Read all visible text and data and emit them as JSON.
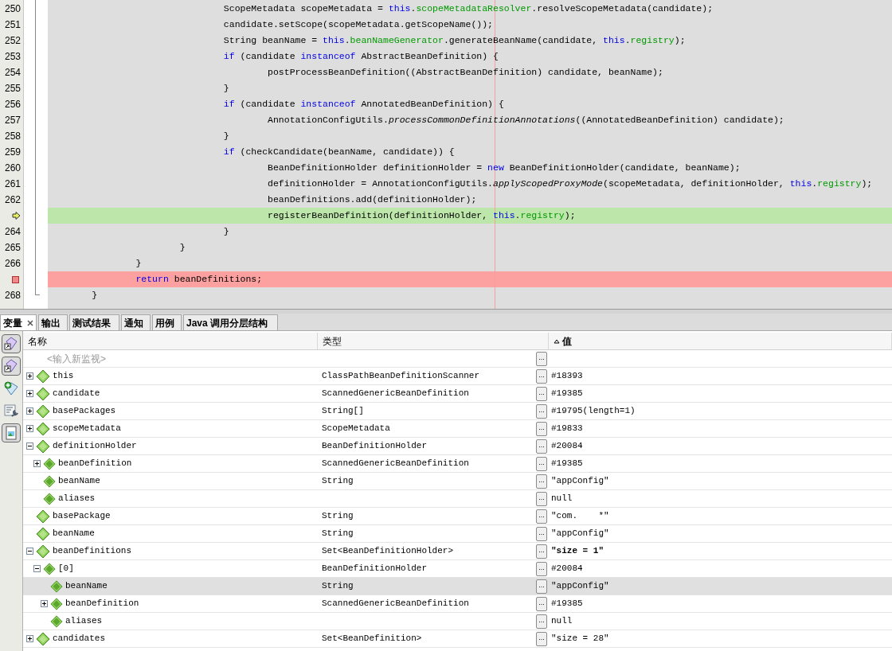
{
  "editor": {
    "lines": [
      {
        "number": "250",
        "kind": "normal",
        "segments": [
          {
            "kind": "plain",
            "text": "                                ScopeMetadata scopeMetadata = "
          },
          {
            "kind": "keyword",
            "text": "this"
          },
          {
            "kind": "plain",
            "text": "."
          },
          {
            "kind": "field",
            "text": "scopeMetadataResolver"
          },
          {
            "kind": "plain",
            "text": ".resolveScopeMetadata(candidate);"
          }
        ]
      },
      {
        "number": "251",
        "kind": "normal",
        "segments": [
          {
            "kind": "plain",
            "text": "                                candidate.setScope(scopeMetadata.getScopeName());"
          }
        ]
      },
      {
        "number": "252",
        "kind": "normal",
        "segments": [
          {
            "kind": "plain",
            "text": "                                String beanName = "
          },
          {
            "kind": "keyword",
            "text": "this"
          },
          {
            "kind": "plain",
            "text": "."
          },
          {
            "kind": "field",
            "text": "beanNameGenerator"
          },
          {
            "kind": "plain",
            "text": ".generateBeanName(candidate, "
          },
          {
            "kind": "keyword",
            "text": "this"
          },
          {
            "kind": "plain",
            "text": "."
          },
          {
            "kind": "field",
            "text": "registry"
          },
          {
            "kind": "plain",
            "text": ");"
          }
        ]
      },
      {
        "number": "253",
        "kind": "normal",
        "segments": [
          {
            "kind": "keyword",
            "text": "                                if"
          },
          {
            "kind": "plain",
            "text": " (candidate "
          },
          {
            "kind": "keyword",
            "text": "instanceof"
          },
          {
            "kind": "plain",
            "text": " AbstractBeanDefinition) {"
          }
        ]
      },
      {
        "number": "254",
        "kind": "normal",
        "segments": [
          {
            "kind": "plain",
            "text": "                                        postProcessBeanDefinition((AbstractBeanDefinition) candidate, beanName);"
          }
        ]
      },
      {
        "number": "255",
        "kind": "normal",
        "segments": [
          {
            "kind": "plain",
            "text": "                                }"
          }
        ]
      },
      {
        "number": "256",
        "kind": "normal",
        "segments": [
          {
            "kind": "keyword",
            "text": "                                if"
          },
          {
            "kind": "plain",
            "text": " (candidate "
          },
          {
            "kind": "keyword",
            "text": "instanceof"
          },
          {
            "kind": "plain",
            "text": " AnnotatedBeanDefinition) {"
          }
        ]
      },
      {
        "number": "257",
        "kind": "normal",
        "segments": [
          {
            "kind": "plain",
            "text": "                                        AnnotationConfigUtils."
          },
          {
            "kind": "static",
            "text": "processCommonDefinitionAnnotations"
          },
          {
            "kind": "plain",
            "text": "((AnnotatedBeanDefinition) candidate);"
          }
        ]
      },
      {
        "number": "258",
        "kind": "normal",
        "segments": [
          {
            "kind": "plain",
            "text": "                                }"
          }
        ]
      },
      {
        "number": "259",
        "kind": "normal",
        "segments": [
          {
            "kind": "keyword",
            "text": "                                if"
          },
          {
            "kind": "plain",
            "text": " (checkCandidate(beanName, candidate)) {"
          }
        ]
      },
      {
        "number": "260",
        "kind": "normal",
        "segments": [
          {
            "kind": "plain",
            "text": "                                        BeanDefinitionHolder definitionHolder = "
          },
          {
            "kind": "keyword",
            "text": "new"
          },
          {
            "kind": "plain",
            "text": " BeanDefinitionHolder(candidate, beanName);"
          }
        ]
      },
      {
        "number": "261",
        "kind": "normal",
        "segments": [
          {
            "kind": "plain",
            "text": "                                        definitionHolder = AnnotationConfigUtils."
          },
          {
            "kind": "static",
            "text": "applyScopedProxyMode"
          },
          {
            "kind": "plain",
            "text": "(scopeMetadata, definitionHolder, "
          },
          {
            "kind": "keyword",
            "text": "this"
          },
          {
            "kind": "plain",
            "text": "."
          },
          {
            "kind": "field",
            "text": "registry"
          },
          {
            "kind": "plain",
            "text": ");"
          }
        ]
      },
      {
        "number": "262",
        "kind": "normal",
        "segments": [
          {
            "kind": "plain",
            "text": "                                        beanDefinitions.add(definitionHolder);"
          }
        ]
      },
      {
        "kind": "current",
        "segments": [
          {
            "kind": "plain",
            "text": "                                        registerBeanDefinition(definitionHolder, "
          },
          {
            "kind": "keyword",
            "text": "this"
          },
          {
            "kind": "plain",
            "text": "."
          },
          {
            "kind": "field",
            "text": "registry"
          },
          {
            "kind": "plain",
            "text": ");"
          }
        ]
      },
      {
        "number": "264",
        "kind": "normal",
        "segments": [
          {
            "kind": "plain",
            "text": "                                }"
          }
        ]
      },
      {
        "number": "265",
        "kind": "normal",
        "segments": [
          {
            "kind": "plain",
            "text": "                        }"
          }
        ]
      },
      {
        "number": "266",
        "kind": "normal",
        "segments": [
          {
            "kind": "plain",
            "text": "                }"
          }
        ]
      },
      {
        "kind": "breakpoint",
        "segments": [
          {
            "kind": "keyword",
            "text": "                return"
          },
          {
            "kind": "plain",
            "text": " beanDefinitions;"
          }
        ]
      },
      {
        "number": "268",
        "kind": "normal",
        "segments": [
          {
            "kind": "plain",
            "text": "        }"
          }
        ]
      }
    ]
  },
  "tabs": [
    {
      "label": "变量",
      "selected": true,
      "closable": true
    },
    {
      "label": "输出",
      "selected": false,
      "closable": false
    },
    {
      "label": "测试结果",
      "selected": false,
      "closable": false
    },
    {
      "label": "通知",
      "selected": false,
      "closable": false
    },
    {
      "label": "用例",
      "selected": false,
      "closable": false
    },
    {
      "label": "Java 调用分层结构",
      "selected": false,
      "closable": false
    }
  ],
  "toolbar": [
    {
      "kind": "diamond-arrow",
      "pressed": true
    },
    {
      "kind": "diamond-arrow",
      "pressed": true
    },
    {
      "kind": "diamond-plus",
      "pressed": false
    },
    {
      "kind": "form-wrench",
      "pressed": false
    },
    {
      "kind": "picture",
      "pressed": true
    }
  ],
  "table": {
    "columns": [
      {
        "label": "名称",
        "sorted": false
      },
      {
        "label": "类型",
        "sorted": false
      },
      {
        "label": "值",
        "sorted": true
      }
    ],
    "watch": {
      "placeholder": "<输入新监视>",
      "value_button": "..."
    },
    "rows": [
      {
        "name": "this",
        "type": "ClassPathBeanDefinitionScanner",
        "value": "#18393",
        "value_button": "...",
        "expanded": false,
        "selected": false
      },
      {
        "name": "candidate",
        "type": "ScannedGenericBeanDefinition",
        "value": "#19385",
        "value_button": "...",
        "expanded": false,
        "selected": false
      },
      {
        "name": "basePackages",
        "type": "String[]",
        "value": "#19795(length=1)",
        "value_button": "...",
        "expanded": false,
        "selected": false
      },
      {
        "name": "scopeMetadata",
        "type": "ScopeMetadata",
        "value": "#19833",
        "value_button": "...",
        "expanded": false,
        "selected": false
      },
      {
        "name": "definitionHolder",
        "type": "BeanDefinitionHolder",
        "value": "#20084",
        "value_button": "...",
        "expanded": true,
        "selected": false,
        "children": [
          {
            "name": "beanDefinition",
            "type": "ScannedGenericBeanDefinition",
            "value": "#19385",
            "value_button": "...",
            "expanded": false,
            "selected": false
          },
          {
            "name": "beanName",
            "type": "String",
            "value": "\"appConfig\"",
            "value_button": "...",
            "selected": false
          },
          {
            "name": "aliases",
            "value": "null",
            "value_button": "...",
            "selected": false
          }
        ]
      },
      {
        "name": "basePackage",
        "type": "String",
        "value": "\"com.    *\"",
        "value_button": "...",
        "selected": false
      },
      {
        "name": "beanName",
        "type": "String",
        "value": "\"appConfig\"",
        "value_button": "...",
        "selected": false
      },
      {
        "name": "beanDefinitions",
        "type": "Set<BeanDefinitionHolder>",
        "value": "\"size = 1\"",
        "value_bold": true,
        "value_button": "...",
        "expanded": true,
        "selected": false,
        "children": [
          {
            "name": "[0]",
            "type": "BeanDefinitionHolder",
            "value": "#20084",
            "value_button": "...",
            "expanded": true,
            "selected": false,
            "children": [
              {
                "name": "beanName",
                "type": "String",
                "value": "\"appConfig\"",
                "value_button": "...",
                "selected": true
              },
              {
                "name": "beanDefinition",
                "type": "ScannedGenericBeanDefinition",
                "value": "#19385",
                "value_button": "...",
                "expanded": false,
                "selected": false
              },
              {
                "name": "aliases",
                "value": "null",
                "value_button": "...",
                "selected": false
              }
            ]
          }
        ]
      },
      {
        "name": "candidates",
        "type": "Set<BeanDefinition>",
        "value": "\"size = 28\"",
        "value_button": "...",
        "expanded": false,
        "selected": false
      }
    ]
  }
}
